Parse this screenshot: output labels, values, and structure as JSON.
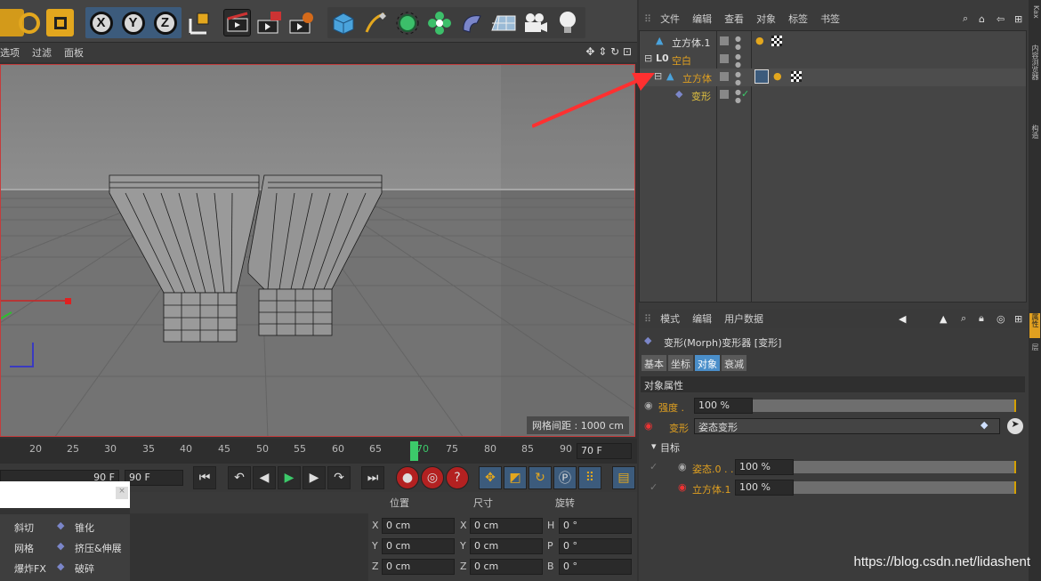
{
  "viewport": {
    "menu": [
      "选项",
      "过滤",
      "面板"
    ],
    "status_text": "网格间距 : 1000 cm"
  },
  "timeline": {
    "ticks": [
      "20",
      "25",
      "30",
      "35",
      "40",
      "45",
      "50",
      "55",
      "60",
      "65",
      "70",
      "75",
      "80",
      "85",
      "90"
    ],
    "end_field": "70 F",
    "current_frame": "90 F",
    "max_field": "90 F"
  },
  "object_manager": {
    "menu": [
      "文件",
      "编辑",
      "查看",
      "对象",
      "标签",
      "书签"
    ],
    "objects": [
      {
        "name": "立方体.1",
        "color": "#e8e8e8"
      },
      {
        "name": "空白",
        "color": "#e0a020"
      },
      {
        "name": "立方体",
        "color": "#e0a020"
      },
      {
        "name": "变形",
        "color": "#e0c040"
      }
    ]
  },
  "attribute_manager": {
    "menu": [
      "模式",
      "编辑",
      "用户数据"
    ],
    "title": "变形(Morph)变形器 [变形]",
    "tabs": [
      "基本",
      "坐标",
      "对象",
      "衰减"
    ],
    "active_tab": "对象",
    "section_title": "对象属性",
    "strength_label": "强度 .",
    "strength_value": "100 %",
    "strength_fill": 1.0,
    "morph_label": "变形",
    "morph_value": "姿态变形",
    "target_section": "目标",
    "targets": [
      {
        "label": "姿态.0 . .",
        "value": "100 %",
        "fill": 1.0,
        "color": "#e0a020"
      },
      {
        "label": "立方体.1",
        "value": "100 %",
        "fill": 1.0,
        "color": "#e0a020"
      }
    ]
  },
  "coordinates": {
    "headers": [
      "位置",
      "尺寸",
      "旋转"
    ],
    "rows": [
      {
        "a": "X",
        "av": "0 cm",
        "b": "X",
        "bv": "0 cm",
        "c": "H",
        "cv": "0 °"
      },
      {
        "a": "Y",
        "av": "0 cm",
        "b": "Y",
        "bv": "0 cm",
        "c": "P",
        "cv": "0 °"
      },
      {
        "a": "Z",
        "av": "0 cm",
        "b": "Z",
        "bv": "0 cm",
        "c": "B",
        "cv": "0 °"
      }
    ]
  },
  "deformers": [
    {
      "label": "斜切"
    },
    {
      "label": "锥化"
    },
    {
      "label": "网格"
    },
    {
      "label": "挤压&伸展"
    },
    {
      "label": "爆炸FX"
    },
    {
      "label": "破碎"
    }
  ],
  "right_strip": [
    "Kax",
    "内容浏览器",
    "构造",
    "属性",
    "层"
  ],
  "watermark": "https://blog.csdn.net/lidashent",
  "colors": {
    "accent": "#3c5b7c",
    "highlight": "#e0a020",
    "arrow": "#ff3030"
  }
}
